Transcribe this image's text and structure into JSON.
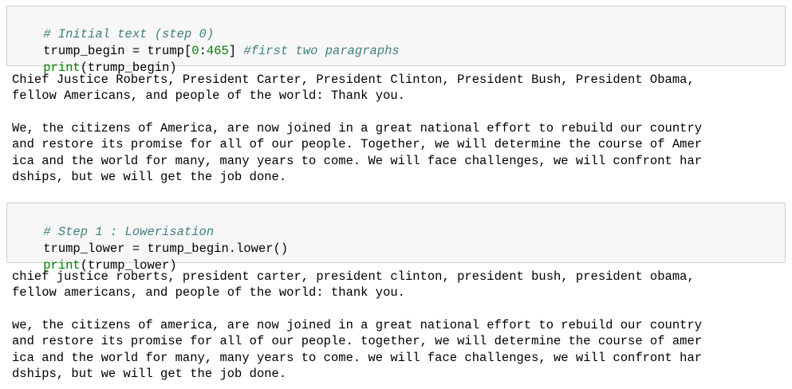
{
  "cells": [
    {
      "input": {
        "line1_comment": "# Initial text (step 0)",
        "line2_var": "trump_begin",
        "line2_eq": " = ",
        "line2_obj": "trump[",
        "line2_n1": "0",
        "line2_colon": ":",
        "line2_n2": "465",
        "line2_close": "] ",
        "line2_comment": "#first two paragraphs",
        "line3_func": "print",
        "line3_args": "(trump_begin)"
      },
      "output": [
        "Chief Justice Roberts, President Carter, President Clinton, President Bush, President Obama,",
        "fellow Americans, and people of the world: Thank you.",
        "",
        "We, the citizens of America, are now joined in a great national effort to rebuild our country",
        "and restore its promise for all of our people. Together, we will determine the course of Amer",
        "ica and the world for many, many years to come. We will face challenges, we will confront har",
        "dships, but we will get the job done."
      ]
    },
    {
      "input": {
        "line1_comment": "# Step 1 : Lowerisation",
        "line2_var": "trump_lower",
        "line2_eq": " = ",
        "line2_obj": "trump_begin.lower()",
        "line3_func": "print",
        "line3_args": "(trump_lower)"
      },
      "output": [
        "chief justice roberts, president carter, president clinton, president bush, president obama,",
        "fellow americans, and people of the world: thank you.",
        "",
        "we, the citizens of america, are now joined in a great national effort to rebuild our country",
        "and restore its promise for all of our people. together, we will determine the course of amer",
        "ica and the world for many, many years to come. we will face challenges, we will confront har",
        "dships, but we will get the job done."
      ]
    }
  ],
  "colors": {
    "comment": "#408080",
    "builtin": "#008000",
    "cell_bg": "#f7f7f7",
    "cell_border": "#cfcfcf"
  }
}
